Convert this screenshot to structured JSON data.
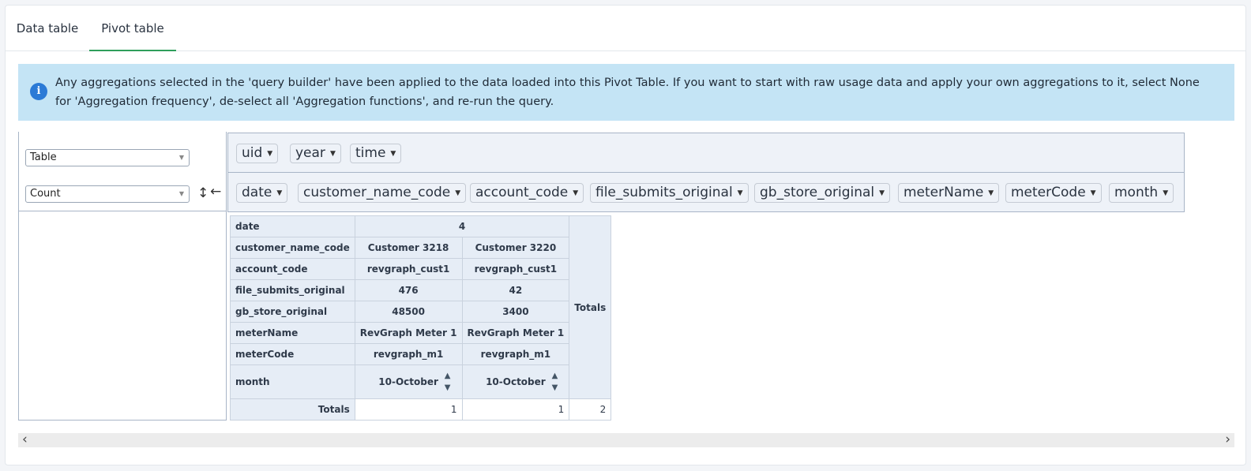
{
  "tabs": [
    "Data table",
    "Pivot table"
  ],
  "banner": {
    "text": "Any aggregations selected in the 'query builder' have been applied to the data loaded into this Pivot Table. If you want to start with raw usage data and apply your own aggregations to it, select None for 'Aggregation frequency', de-select all 'Aggregation functions', and re-run the query."
  },
  "controls": {
    "renderer": "Table",
    "aggregator": "Count",
    "updown": "↕",
    "leftarrow": "←"
  },
  "col_attrs": [
    "uid",
    "year",
    "time"
  ],
  "row_attrs": [
    "date",
    "customer_name_code",
    "account_code",
    "file_submits_original",
    "gb_store_original",
    "meterName",
    "meterCode",
    "month"
  ],
  "table": {
    "date_value": "4",
    "totals_label": "Totals",
    "rows": [
      {
        "label": "customer_name_code",
        "v1": "Customer 3218",
        "v2": "Customer 3220"
      },
      {
        "label": "account_code",
        "v1": "revgraph_cust1",
        "v2": "revgraph_cust1"
      },
      {
        "label": "file_submits_original",
        "v1": "476",
        "v2": "42"
      },
      {
        "label": "gb_store_original",
        "v1": "48500",
        "v2": "3400"
      },
      {
        "label": "meterName",
        "v1": "RevGraph Meter 1",
        "v2": "RevGraph Meter 1"
      },
      {
        "label": "meterCode",
        "v1": "revgraph_m1",
        "v2": "revgraph_m1"
      },
      {
        "label": "month",
        "v1": "10-October",
        "v2": "10-October"
      }
    ],
    "totals_row": {
      "label": "Totals",
      "v1": "1",
      "v2": "1",
      "grand": "2"
    }
  },
  "sort_icons": {
    "up": "▲",
    "down": "▼"
  },
  "scroll": {
    "left": "‹",
    "right": "›"
  }
}
